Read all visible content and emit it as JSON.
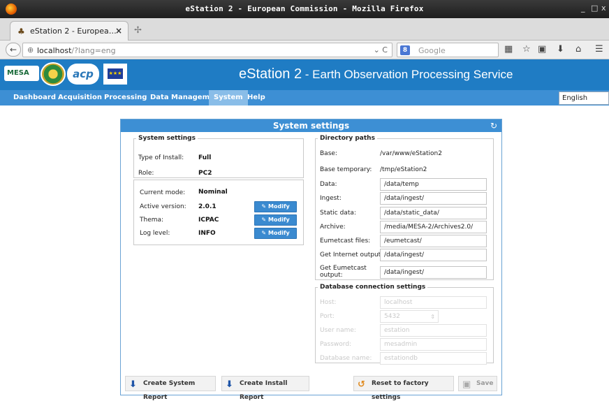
{
  "browser": {
    "window_title": "eStation 2 - European Commission - Mozilla Firefox",
    "window_controls": [
      "_",
      "□",
      "x"
    ],
    "tab": {
      "label": "eStation 2 - Europea…",
      "close": "×"
    },
    "new_tab": "✢",
    "url_host": "localhost",
    "url_rest": "/?lang=eng",
    "url_controls": "⌄ C",
    "search_placeholder": "Google",
    "search_engine_letter": "8"
  },
  "app": {
    "title_main": "eStation 2",
    "title_sub": " - Earth Observation Processing Service",
    "logos": {
      "mesa": "MESA",
      "acp": "acp",
      "eu_stars": "★★★"
    }
  },
  "menu": {
    "items": [
      "Dashboard",
      "Acquisition",
      "Processing",
      "Data Management",
      "System",
      "Help"
    ],
    "active": "System",
    "language": "English"
  },
  "panel": {
    "title": "System settings",
    "refresh_icon": "↻",
    "system_settings": {
      "legend": "System settings",
      "type_of_install_label": "Type of Install:",
      "type_of_install_value": "Full",
      "role_label": "Role:",
      "role_value": "PC2"
    },
    "modes": {
      "current_mode_label": "Current mode:",
      "current_mode_value": "Nominal",
      "active_version_label": "Active version:",
      "active_version_value": "2.0.1",
      "thema_label": "Thema:",
      "thema_value": "ICPAC",
      "log_level_label": "Log level:",
      "log_level_value": "INFO",
      "modify_label": "Modify"
    },
    "directory_paths": {
      "legend": "Directory paths",
      "base_label": "Base:",
      "base_value": "/var/www/eStation2",
      "base_temp_label": "Base temporary:",
      "base_temp_value": "/tmp/eStation2",
      "data_label": "Data:",
      "data_value": "/data/temp",
      "ingest_label": "Ingest:",
      "ingest_value": "/data/ingest/",
      "static_label": "Static data:",
      "static_value": "/data/static_data/",
      "archive_label": "Archive:",
      "archive_value": "/media/MESA-2/Archives2.0/",
      "eumetcast_label": "Eumetcast files:",
      "eumetcast_value": "/eumetcast/",
      "get_internet_label": "Get Internet output:",
      "get_internet_value": "/data/ingest/",
      "get_eumetcast_label": "Get Eumetcast output:",
      "get_eumetcast_value": "/data/ingest/"
    },
    "database": {
      "legend": "Database connection settings",
      "host_label": "Host:",
      "host_value": "localhost",
      "port_label": "Port:",
      "port_value": "5432",
      "user_label": "User name:",
      "user_value": "estation",
      "password_label": "Password:",
      "password_value": "mesadmin",
      "dbname_label": "Database name:",
      "dbname_value": "estationdb"
    },
    "footer": {
      "create_system_report": "Create System Report",
      "create_install_report": "Create Install Report",
      "reset": "Reset to factory settings",
      "save": "Save"
    }
  },
  "colors": {
    "header_blue": "#1f7cc4",
    "menu_blue": "#3d8fd4",
    "active_tab": "#89bde8",
    "button_blue": "#3a8ad0"
  }
}
